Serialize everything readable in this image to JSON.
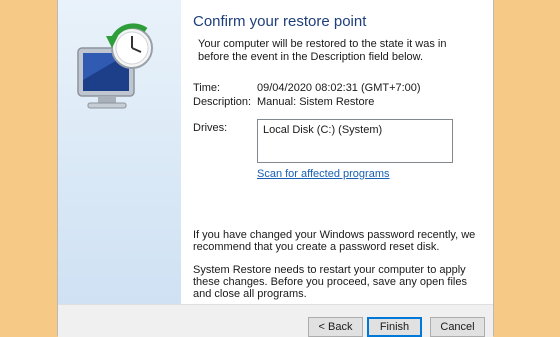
{
  "dialog": {
    "heading": "Confirm your restore point",
    "intro": "Your computer will be restored to the state it was in before the event in the Description field below.",
    "details": {
      "time_label": "Time:",
      "time_value": "09/04/2020 08:02:31 (GMT+7:00)",
      "description_label": "Description:",
      "description_value": "Manual: Sistem Restore",
      "drives_label": "Drives:",
      "drives_list": [
        "Local Disk (C:) (System)"
      ]
    },
    "scan_link": "Scan for affected programs",
    "password_note": "If you have changed your Windows password recently, we recommend that you create a password reset disk.",
    "restart_note": "System Restore needs to restart your computer to apply these changes. Before you proceed, save any open files and close all programs."
  },
  "buttons": {
    "back": "< Back",
    "finish": "Finish",
    "cancel": "Cancel"
  },
  "colors": {
    "desktop_bg": "#f7c987",
    "heading": "#1e3f7a",
    "link": "#1a5fb4",
    "default_button_border": "#0078d7"
  },
  "icons": {
    "side_illustration": "system-restore-icon"
  }
}
